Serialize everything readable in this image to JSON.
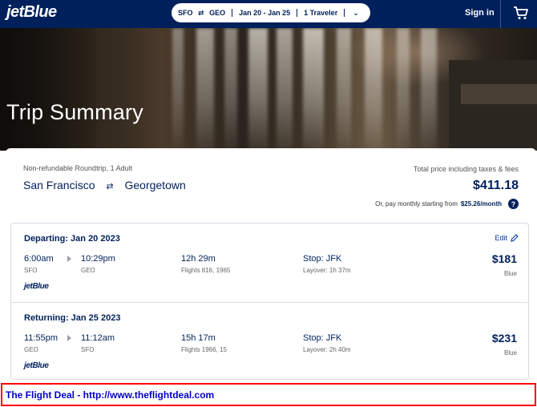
{
  "header": {
    "logo": "jetBlue",
    "trip_pill": {
      "from": "SFO",
      "swap": "⇄",
      "to": "GEO",
      "dates": "Jan 20 - Jan 25",
      "travelers": "1 Traveler",
      "chevron": "⌄"
    },
    "signin": "Sign in",
    "cart_icon": "cart-icon"
  },
  "hero": {
    "title": "Trip Summary"
  },
  "summary": {
    "fare_type": "Non-refundable Roundtrip, 1 Adult",
    "origin": "San Francisco",
    "swap": "⇄",
    "destination": "Georgetown",
    "total_label": "Total price including taxes & fees",
    "total_price": "$411.18",
    "monthly_prefix": "Or, pay monthly starting from",
    "monthly_amount": "$25.26/month",
    "help": "?"
  },
  "legs": [
    {
      "title": "Departing: Jan 20 2023",
      "edit": "Edit",
      "depart_time": "6:00am",
      "depart_code": "SFO",
      "arrive_time": "10:29pm",
      "arrive_code": "GEO",
      "duration": "12h 29m",
      "flights": "Flights 816, 1965",
      "stop": "Stop: JFK",
      "layover": "Layover: 1h 37m",
      "price": "$181",
      "cabin": "Blue",
      "carrier": "jetBlue"
    },
    {
      "title": "Returning: Jan 25 2023",
      "depart_time": "11:55pm",
      "depart_code": "GEO",
      "arrive_time": "11:12am",
      "arrive_code": "SFO",
      "duration": "15h 17m",
      "flights": "Flights 1966, 15",
      "stop": "Stop: JFK",
      "layover": "Layover: 2h 40m",
      "price": "$231",
      "cabin": "Blue",
      "carrier": "jetBlue"
    }
  ],
  "banner": {
    "text": "The Flight Deal - http://www.theflightdeal.com"
  },
  "colors": {
    "brand_navy": "#00205b",
    "link_blue": "#0033a0",
    "banner_border": "#ff0000",
    "banner_text": "#0000cc"
  }
}
